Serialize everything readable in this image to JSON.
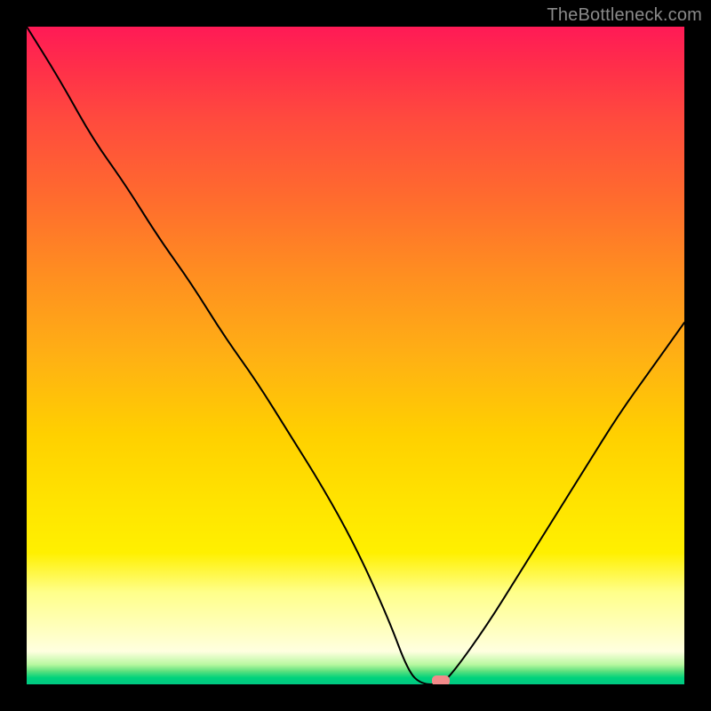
{
  "watermark": "TheBottleneck.com",
  "chart_data": {
    "type": "line",
    "title": "",
    "xlabel": "",
    "ylabel": "",
    "xlim": [
      0,
      100
    ],
    "ylim": [
      0,
      100
    ],
    "grid": false,
    "legend": false,
    "background_gradient_meaning": "top=high bottleneck (red), bottom=optimal (green)",
    "series": [
      {
        "name": "bottleneck-curve",
        "x": [
          0,
          5,
          10,
          15,
          20,
          25,
          30,
          35,
          40,
          45,
          50,
          55,
          58,
          60,
          63,
          65,
          70,
          75,
          80,
          85,
          90,
          95,
          100
        ],
        "values": [
          100,
          92,
          83,
          76,
          68,
          61,
          53,
          46,
          38,
          30,
          21,
          10,
          2,
          0,
          0,
          2,
          9,
          17,
          25,
          33,
          41,
          48,
          55
        ]
      }
    ],
    "marker": {
      "x": 63,
      "y": 0,
      "color": "#f38a8a"
    }
  }
}
